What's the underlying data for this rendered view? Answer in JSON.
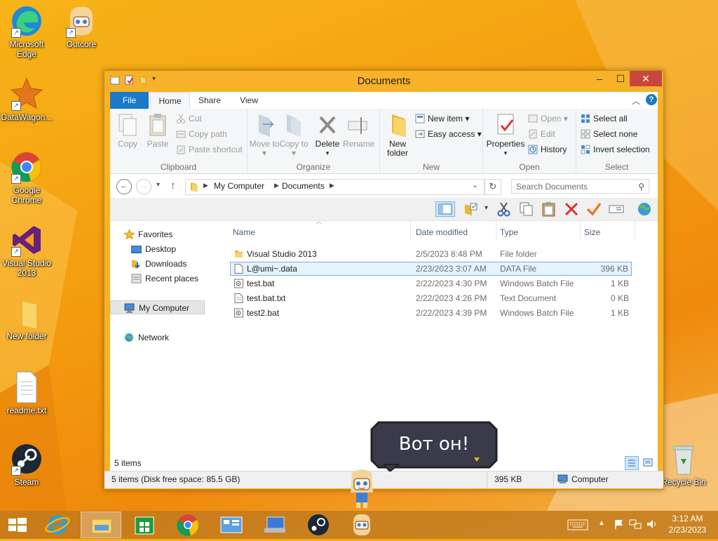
{
  "desktop": {
    "icons": [
      {
        "label": "Microsoft Edge"
      },
      {
        "label": "Outcore"
      },
      {
        "label": "DataWagon..."
      },
      {
        "label": "Google Chrome"
      },
      {
        "label": "Visual Studio 2013"
      },
      {
        "label": "New folder"
      },
      {
        "label": "readme.txt"
      },
      {
        "label": "Steam"
      },
      {
        "label": "Recycle Bin"
      }
    ]
  },
  "window": {
    "title": "Documents",
    "minimize": "‒",
    "maximize": "☐",
    "close": "✕",
    "tabs": {
      "file": "File",
      "home": "Home",
      "share": "Share",
      "view": "View"
    },
    "ribbon": {
      "clipboard": {
        "label": "Clipboard",
        "copy": "Copy",
        "paste": "Paste",
        "cut": "Cut",
        "copy_path": "Copy path",
        "paste_shortcut": "Paste shortcut"
      },
      "organize": {
        "label": "Organize",
        "move_to": "Move to ▾",
        "copy_to": "Copy to ▾",
        "delete": "Delete",
        "rename": "Rename"
      },
      "new": {
        "label": "New",
        "new_folder": "New folder",
        "new_item": "New item ▾",
        "easy_access": "Easy access ▾"
      },
      "open": {
        "label": "Open",
        "properties": "Properties",
        "open": "Open ▾",
        "edit": "Edit",
        "history": "History"
      },
      "select": {
        "label": "Select",
        "select_all": "Select all",
        "select_none": "Select none",
        "invert_selection": "Invert selection"
      }
    },
    "address": {
      "crumbs": [
        "My Computer",
        "Documents"
      ],
      "search_placeholder": "Search Documents"
    },
    "nav": {
      "favorites": "Favorites",
      "desktop": "Desktop",
      "downloads": "Downloads",
      "recent_places": "Recent places",
      "my_computer": "My Computer",
      "network": "Network"
    },
    "columns": {
      "name": "Name",
      "date": "Date modified",
      "type": "Type",
      "size": "Size"
    },
    "files": [
      {
        "name": "Visual Studio 2013",
        "date": "2/5/2023 8:48 PM",
        "type": "File folder",
        "size": ""
      },
      {
        "name": "L@umi~.data",
        "date": "2/23/2023 3:07 AM",
        "type": "DATA File",
        "size": "396 KB"
      },
      {
        "name": "test.bat",
        "date": "2/22/2023 4:30 PM",
        "type": "Windows Batch File",
        "size": "1 KB"
      },
      {
        "name": "test.bat.txt",
        "date": "2/22/2023 4:26 PM",
        "type": "Text Document",
        "size": "0 KB"
      },
      {
        "name": "test2.bat",
        "date": "2/22/2023 4:39 PM",
        "type": "Windows Batch File",
        "size": "1 KB"
      }
    ],
    "status": {
      "items": "5 items",
      "details": "5 items (Disk free space: 85.5 GB)",
      "size": "395 KB",
      "location": "Computer"
    }
  },
  "speech": {
    "text": "Вот он!"
  },
  "taskbar": {
    "time": "3:12 AM",
    "date": "2/23/2023"
  },
  "colors": {
    "file_tab": "#1979ca",
    "selection_bg": "#e5f3fb",
    "close_button": "#c7473c",
    "desktop_orange": "#f4a012"
  }
}
